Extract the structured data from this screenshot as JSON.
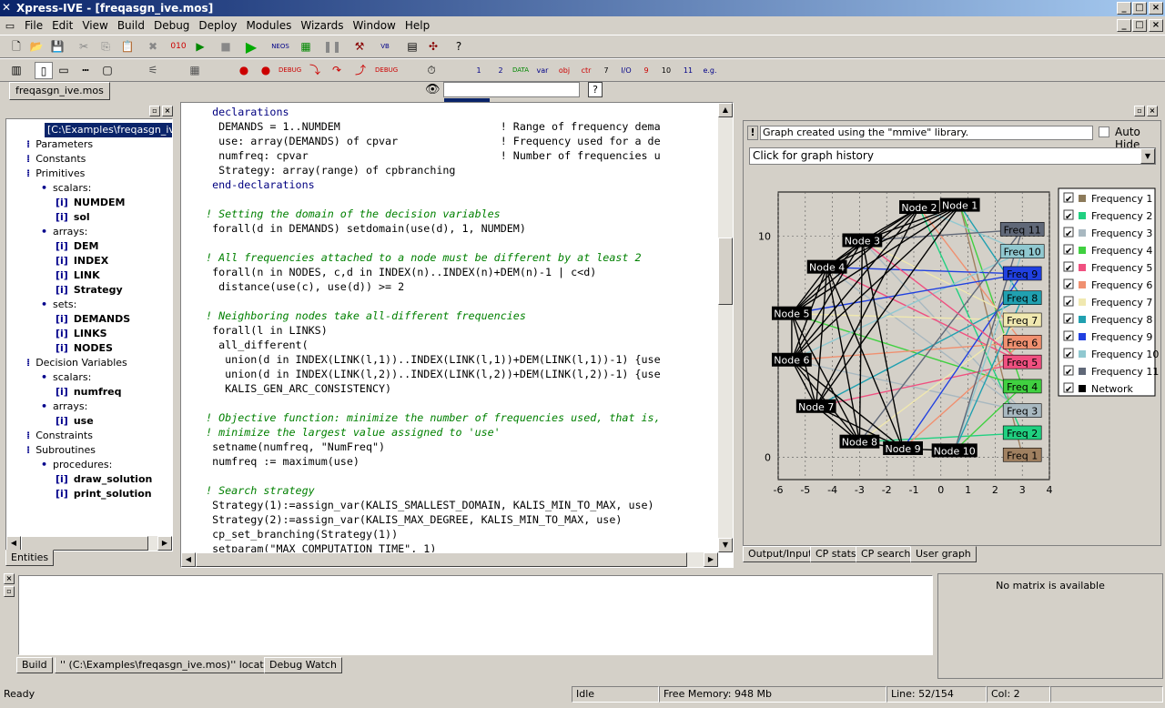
{
  "window": {
    "title": "Xpress-IVE - [freqasgn_ive.mos]"
  },
  "menu": [
    "File",
    "Edit",
    "View",
    "Build",
    "Debug",
    "Deploy",
    "Modules",
    "Wizards",
    "Window",
    "Help"
  ],
  "doc_tab": "freqasgn_ive.mos",
  "tree": {
    "root": "[C:\\Examples\\freqasgn_ive.",
    "items": [
      {
        "label": "Parameters",
        "depth": 1
      },
      {
        "label": "Constants",
        "depth": 1
      },
      {
        "label": "Primitives",
        "depth": 1
      },
      {
        "label": "scalars:",
        "depth": 2
      },
      {
        "label": "NUMDEM",
        "depth": 3,
        "bold": true
      },
      {
        "label": "sol",
        "depth": 3,
        "bold": true
      },
      {
        "label": "arrays:",
        "depth": 2
      },
      {
        "label": "DEM",
        "depth": 3,
        "bold": true
      },
      {
        "label": "INDEX",
        "depth": 3,
        "bold": true
      },
      {
        "label": "LINK",
        "depth": 3,
        "bold": true
      },
      {
        "label": "Strategy",
        "depth": 3,
        "bold": true
      },
      {
        "label": "sets:",
        "depth": 2
      },
      {
        "label": "DEMANDS",
        "depth": 3,
        "bold": true
      },
      {
        "label": "LINKS",
        "depth": 3,
        "bold": true
      },
      {
        "label": "NODES",
        "depth": 3,
        "bold": true
      },
      {
        "label": "Decision Variables",
        "depth": 1
      },
      {
        "label": "scalars:",
        "depth": 2
      },
      {
        "label": "numfreq",
        "depth": 3,
        "bold": true
      },
      {
        "label": "arrays:",
        "depth": 2
      },
      {
        "label": "use",
        "depth": 3,
        "bold": true
      },
      {
        "label": "Constraints",
        "depth": 1
      },
      {
        "label": "Subroutines",
        "depth": 1
      },
      {
        "label": "procedures:",
        "depth": 2
      },
      {
        "label": "draw_solution",
        "depth": 3,
        "bold": true
      },
      {
        "label": "print_solution",
        "depth": 3,
        "bold": true
      }
    ],
    "tab": "Entities"
  },
  "code": [
    "  declarations",
    "   DEMANDS = 1..NUMDEM                         ! Range of frequency dema",
    "   use: array(DEMANDS) of cpvar                ! Frequency used for a de",
    "   numfreq: cpvar                              ! Number of frequencies u",
    "   Strategy: array(range) of cpbranching",
    "  end-declarations",
    "",
    " ! Setting the domain of the decision variables",
    "  forall(d in DEMANDS) setdomain(use(d), 1, NUMDEM)",
    "",
    " ! All frequencies attached to a node must be different by at least 2",
    "  forall(n in NODES, c,d in INDEX(n)..INDEX(n)+DEM(n)-1 | c<d)",
    "   distance(use(c), use(d)) >= 2",
    "",
    " ! Neighboring nodes take all-different frequencies",
    "  forall(l in LINKS)",
    "   all_different(",
    "    union(d in INDEX(LINK(l,1))..INDEX(LINK(l,1))+DEM(LINK(l,1))-1) {use",
    "    union(d in INDEX(LINK(l,2))..INDEX(LINK(l,2))+DEM(LINK(l,2))-1) {use",
    "    KALIS_GEN_ARC_CONSISTENCY)",
    "",
    " ! Objective function: minimize the number of frequencies used, that is,",
    " ! minimize the largest value assigned to 'use'",
    "  setname(numfreq, \"NumFreq\")",
    "  numfreq := maximum(use)",
    "",
    " ! Search strategy",
    "  Strategy(1):=assign_var(KALIS_SMALLEST_DOMAIN, KALIS_MIN_TO_MAX, use)",
    "  Strategy(2):=assign_var(KALIS_MAX_DEGREE, KALIS_MIN_TO_MAX, use)",
    "  cp_set_branching(Strategy(1))",
    "  setparam(\"MAX_COMPUTATION_TIME\", 1)"
  ],
  "graph_panel": {
    "info": "Graph created using the \"mmive\" library.",
    "auto_hide": "Auto Hide",
    "history": "Click for graph history",
    "tabs": [
      "Output/Input",
      "CP stats",
      "CP search",
      "User graph"
    ]
  },
  "chart_data": {
    "type": "scatter",
    "xlim": [
      -6,
      4
    ],
    "ylim": [
      -1,
      12
    ],
    "xticks": [
      -6,
      -5,
      -4,
      -3,
      -2,
      -1,
      0,
      1,
      2,
      3,
      4
    ],
    "yticks": [
      0,
      10
    ],
    "nodes": [
      {
        "name": "Node 1",
        "x": 0.7,
        "y": 11.4
      },
      {
        "name": "Node 2",
        "x": -0.8,
        "y": 11.3
      },
      {
        "name": "Node 3",
        "x": -2.9,
        "y": 9.8
      },
      {
        "name": "Node 4",
        "x": -4.2,
        "y": 8.6
      },
      {
        "name": "Node 5",
        "x": -5.5,
        "y": 6.5
      },
      {
        "name": "Node 6",
        "x": -5.5,
        "y": 4.4
      },
      {
        "name": "Node 7",
        "x": -4.6,
        "y": 2.3
      },
      {
        "name": "Node 8",
        "x": -3.0,
        "y": 0.7
      },
      {
        "name": "Node 9",
        "x": -1.4,
        "y": 0.4
      },
      {
        "name": "Node 10",
        "x": 0.5,
        "y": 0.3
      }
    ],
    "freqs": [
      {
        "name": "Freq 11",
        "x": 3.0,
        "y": 10.3,
        "color": "#606878"
      },
      {
        "name": "Freq 10",
        "x": 3.0,
        "y": 9.3,
        "color": "#90c8d0"
      },
      {
        "name": "Freq 9",
        "x": 3.0,
        "y": 8.3,
        "color": "#2040e0"
      },
      {
        "name": "Freq 8",
        "x": 3.0,
        "y": 7.2,
        "color": "#20a0b0"
      },
      {
        "name": "Freq 7",
        "x": 3.0,
        "y": 6.2,
        "color": "#f0e8b0"
      },
      {
        "name": "Freq 6",
        "x": 3.0,
        "y": 5.2,
        "color": "#f09070"
      },
      {
        "name": "Freq 5",
        "x": 3.0,
        "y": 4.3,
        "color": "#f05080"
      },
      {
        "name": "Freq 4",
        "x": 3.0,
        "y": 3.2,
        "color": "#40d040"
      },
      {
        "name": "Freq 3",
        "x": 3.0,
        "y": 2.1,
        "color": "#a8b8c0"
      },
      {
        "name": "Freq 2",
        "x": 3.0,
        "y": 1.1,
        "color": "#20d080"
      },
      {
        "name": "Freq 1",
        "x": 3.0,
        "y": 0.1,
        "color": "#a08060"
      }
    ],
    "legend": [
      {
        "name": "Frequency 1",
        "color": "#8c7a5a"
      },
      {
        "name": "Frequency 2",
        "color": "#20d080"
      },
      {
        "name": "Frequency 3",
        "color": "#a8b8c0"
      },
      {
        "name": "Frequency 4",
        "color": "#40d040"
      },
      {
        "name": "Frequency 5",
        "color": "#f05080"
      },
      {
        "name": "Frequency 6",
        "color": "#f09070"
      },
      {
        "name": "Frequency 7",
        "color": "#f0e8b0"
      },
      {
        "name": "Frequency 8",
        "color": "#20a0b0"
      },
      {
        "name": "Frequency 9",
        "color": "#2040e0"
      },
      {
        "name": "Frequency 10",
        "color": "#90c8d0"
      },
      {
        "name": "Frequency 11",
        "color": "#606878"
      },
      {
        "name": "Network",
        "color": "#000000"
      }
    ],
    "network": [
      [
        0,
        2
      ],
      [
        0,
        3
      ],
      [
        0,
        4
      ],
      [
        0,
        5
      ],
      [
        1,
        2
      ],
      [
        1,
        3
      ],
      [
        1,
        5
      ],
      [
        1,
        6
      ],
      [
        2,
        3
      ],
      [
        2,
        4
      ],
      [
        2,
        5
      ],
      [
        2,
        7
      ],
      [
        3,
        4
      ],
      [
        3,
        5
      ],
      [
        3,
        6
      ],
      [
        3,
        8
      ],
      [
        4,
        5
      ],
      [
        4,
        6
      ],
      [
        4,
        7
      ],
      [
        5,
        6
      ],
      [
        5,
        7
      ],
      [
        5,
        8
      ],
      [
        6,
        7
      ],
      [
        6,
        8
      ],
      [
        7,
        8
      ],
      [
        8,
        9
      ],
      [
        2,
        8
      ],
      [
        3,
        7
      ],
      [
        0,
        6
      ],
      [
        1,
        4
      ]
    ],
    "assign": [
      [
        0,
        10
      ],
      [
        0,
        7
      ],
      [
        0,
        3
      ],
      [
        1,
        9
      ],
      [
        1,
        5
      ],
      [
        1,
        1
      ],
      [
        2,
        8
      ],
      [
        2,
        4
      ],
      [
        2,
        0
      ],
      [
        3,
        8
      ],
      [
        3,
        6
      ],
      [
        3,
        2
      ],
      [
        4,
        7
      ],
      [
        4,
        4
      ],
      [
        5,
        8
      ],
      [
        5,
        5
      ],
      [
        5,
        1
      ],
      [
        6,
        6
      ],
      [
        6,
        3
      ],
      [
        7,
        9
      ],
      [
        7,
        4
      ],
      [
        7,
        0
      ],
      [
        8,
        5
      ],
      [
        8,
        2
      ],
      [
        9,
        7
      ],
      [
        9,
        3
      ],
      [
        9,
        1
      ],
      [
        9,
        0
      ],
      [
        2,
        6
      ],
      [
        4,
        2
      ]
    ]
  },
  "bottom": {
    "tabs": [
      "Build",
      "'' (C:\\Examples\\freqasgn_ive.mos)'' locations",
      "Debug Watch"
    ],
    "matrix": "No matrix is available"
  },
  "status": {
    "ready": "Ready",
    "idle": "Idle",
    "mem": "Free Memory: 948 Mb",
    "line": "Line: 52/154",
    "col": "Col: 2"
  }
}
